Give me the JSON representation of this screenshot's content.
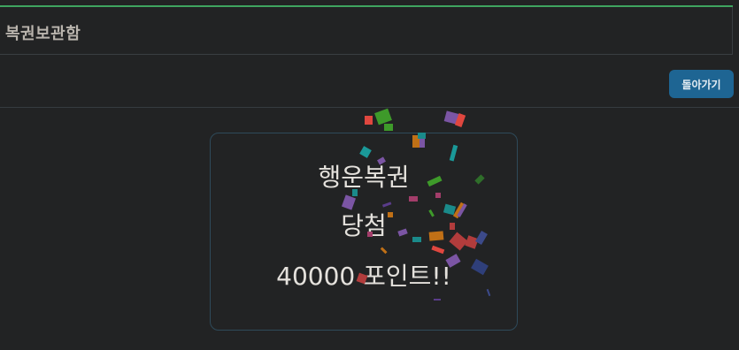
{
  "header": {
    "title": "복권보관함"
  },
  "toolbar": {
    "back_label": "돌아가기"
  },
  "result": {
    "line1": "행운복권",
    "line2": "당첨",
    "line3": "40000 포인트!!"
  },
  "colors": {
    "accent": "#3fa45f",
    "button": "#1e6593",
    "background": "#222324"
  }
}
